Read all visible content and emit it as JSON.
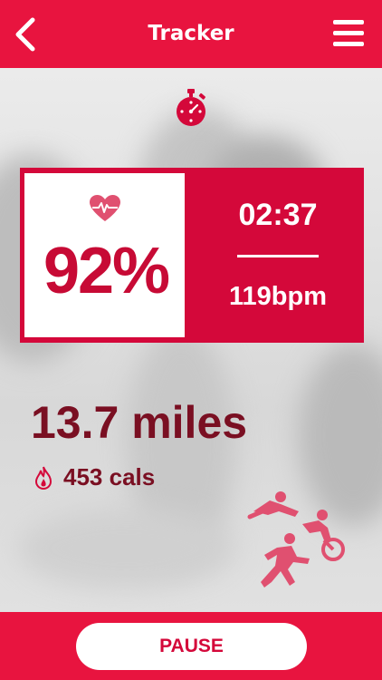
{
  "header": {
    "title": "Tracker",
    "back_icon": "chevron-left-icon",
    "menu_icon": "hamburger-menu-icon"
  },
  "stopwatch_icon": "stopwatch-icon",
  "stats": {
    "heart_icon": "heart-rate-icon",
    "percent": "92%",
    "time": "02:37",
    "bpm": "119bpm"
  },
  "activity": {
    "distance": "13.7 miles",
    "flame_icon": "flame-icon",
    "calories": "453 cals",
    "triathlon_icon": "triathlon-icon"
  },
  "footer": {
    "pause_label": "PAUSE"
  },
  "colors": {
    "brand": "#e8143f",
    "panel": "#d4083a",
    "text_dark_red": "#7a0f22",
    "background": "#e6e6e6"
  }
}
